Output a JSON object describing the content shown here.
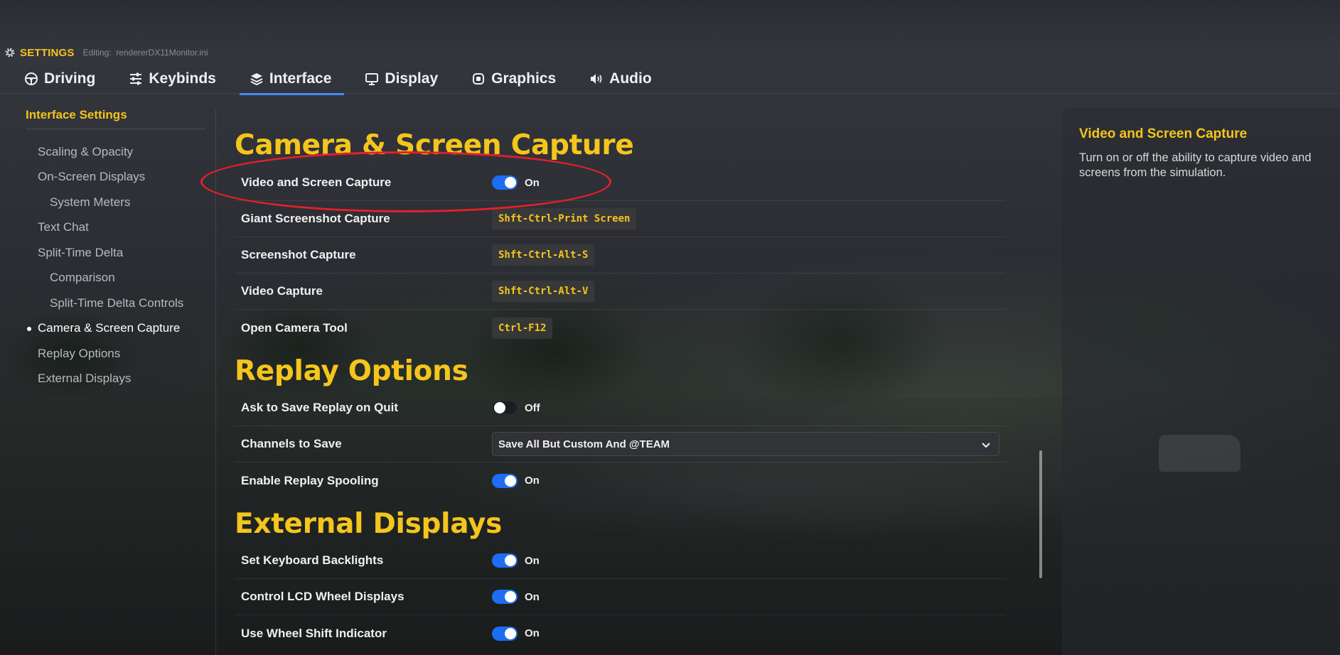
{
  "header": {
    "title": "SETTINGS",
    "editing_label": "Editing:",
    "editing_file": "rendererDX11Monitor.ini"
  },
  "tabs": [
    {
      "label": "Driving",
      "icon": "steering-wheel-icon"
    },
    {
      "label": "Keybinds",
      "icon": "sliders-icon"
    },
    {
      "label": "Interface",
      "icon": "layers-icon",
      "active": true
    },
    {
      "label": "Display",
      "icon": "monitor-icon"
    },
    {
      "label": "Graphics",
      "icon": "chip-icon"
    },
    {
      "label": "Audio",
      "icon": "speaker-icon"
    }
  ],
  "sidebar": {
    "heading": "Interface Settings",
    "items": [
      {
        "label": "Scaling & Opacity",
        "level": 1
      },
      {
        "label": "On-Screen Displays",
        "level": 1
      },
      {
        "label": "System Meters",
        "level": 2
      },
      {
        "label": "Text Chat",
        "level": 1
      },
      {
        "label": "Split-Time Delta",
        "level": 1
      },
      {
        "label": "Comparison",
        "level": 2
      },
      {
        "label": "Split-Time Delta Controls",
        "level": 2
      },
      {
        "label": "Camera & Screen Capture",
        "level": 1,
        "current": true
      },
      {
        "label": "Replay Options",
        "level": 1
      },
      {
        "label": "External Displays",
        "level": 1
      }
    ]
  },
  "sections": {
    "camera": {
      "title": "Camera & Screen Capture",
      "rows": [
        {
          "label": "Video and Screen Capture",
          "type": "toggle",
          "state": "On"
        },
        {
          "label": "Giant Screenshot Capture",
          "type": "keybind",
          "value": "Shft-Ctrl-Print Screen"
        },
        {
          "label": "Screenshot Capture",
          "type": "keybind",
          "value": "Shft-Ctrl-Alt-S"
        },
        {
          "label": "Video Capture",
          "type": "keybind",
          "value": "Shft-Ctrl-Alt-V"
        },
        {
          "label": "Open Camera Tool",
          "type": "keybind",
          "value": "Ctrl-F12"
        }
      ]
    },
    "replay": {
      "title": "Replay Options",
      "rows": [
        {
          "label": "Ask to Save Replay on Quit",
          "type": "toggle",
          "state": "Off"
        },
        {
          "label": "Channels to Save",
          "type": "dropdown",
          "value": "Save All But Custom And @TEAM"
        },
        {
          "label": "Enable Replay Spooling",
          "type": "toggle",
          "state": "On"
        }
      ]
    },
    "external": {
      "title": "External Displays",
      "rows": [
        {
          "label": "Set Keyboard Backlights",
          "type": "toggle",
          "state": "On"
        },
        {
          "label": "Control LCD Wheel Displays",
          "type": "toggle",
          "state": "On"
        },
        {
          "label": "Use Wheel Shift Indicator",
          "type": "toggle",
          "state": "On"
        }
      ]
    }
  },
  "info_panel": {
    "title": "Video and Screen Capture",
    "description": "Turn on or off the ability to capture video and screens from the simulation."
  },
  "colors": {
    "accent_yellow": "#f4c51c",
    "toggle_on": "#1d6ef2",
    "tab_underline": "#3a86ff",
    "highlight_red": "#e4202a"
  }
}
